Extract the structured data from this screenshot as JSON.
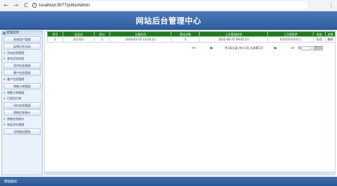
{
  "browser": {
    "url": "localhost:8077/jxhls/Admin",
    "back_icon": "←",
    "forward_icon": "→",
    "reload_icon": "C",
    "menu_icon": "⋮"
  },
  "header": {
    "title": "网站后台管理中心"
  },
  "sidebar": {
    "heading": "管理菜单",
    "items": [
      {
        "type": "button",
        "label": "系统用户管理"
      },
      {
        "type": "button",
        "label": "促销打折活动"
      },
      {
        "type": "category",
        "label": "活动信息管理"
      },
      {
        "type": "category",
        "label": "发布活动信息"
      },
      {
        "type": "button",
        "label": "宣传信息管理"
      },
      {
        "type": "button",
        "label": "客户信息管理"
      },
      {
        "type": "category",
        "label": "客户信息管理"
      },
      {
        "type": "button",
        "label": "销售订单管理"
      },
      {
        "type": "category",
        "label": "销售订单管理"
      },
      {
        "type": "category",
        "label": "已发货订单"
      },
      {
        "type": "button",
        "label": "评价信息管理"
      },
      {
        "type": "button",
        "label": "销售信息统计"
      },
      {
        "type": "category",
        "label": "销售信息统计"
      },
      {
        "type": "category",
        "label": "商品评价管理"
      },
      {
        "type": "button",
        "label": "注销退出登陆"
      }
    ]
  },
  "table": {
    "headers": [
      "序号",
      "会员名",
      "积分",
      "注册时间",
      "登陆次数",
      "上次登陆时间",
      "上次登陆IP",
      "状态",
      "选择"
    ],
    "rows": [
      [
        "1",
        "321321",
        "3",
        "2016-03-10 12:03:12",
        "3",
        "2022-06-25 09:45:53",
        "0:0:0:0:0:0:0:1",
        "在用",
        "删除"
      ]
    ]
  },
  "pager": {
    "first_icon": "⏮",
    "prev_icon": "◀",
    "info": "共1条记录,共计1页,当前第1页",
    "next_icon": "▶",
    "last_icon": "⏭",
    "goto_label": "第",
    "page_value": "",
    "go_label": "页GO"
  },
  "footer": {
    "copyright": "网站版权"
  },
  "colors": {
    "header": "#3a68a8",
    "table_header": "#1f7a1f",
    "sidebar_bg": "#eaf1fa"
  }
}
